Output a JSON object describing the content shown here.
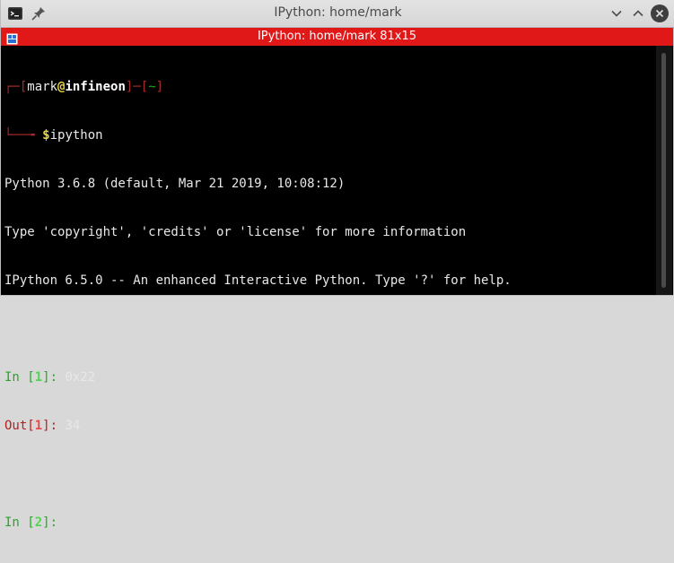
{
  "window": {
    "title": "IPython: home/mark",
    "tab_title": "IPython: home/mark 81x15"
  },
  "icons": {
    "app": "terminal-app-icon",
    "pin": "pin-icon",
    "minimize": "chevron-down-icon",
    "maximize": "chevron-up-icon",
    "close": "close-icon",
    "tab": "split-view-icon"
  },
  "terminal": {
    "prompt": {
      "top_prefix": "┌─[",
      "user": "mark",
      "at": "@",
      "host": "infineon",
      "mid": "]─[",
      "path": "~",
      "end": "]",
      "bottom_prefix": "└──╼ ",
      "dollar": "$",
      "command": "ipython"
    },
    "banner": [
      "Python 3.6.8 (default, Mar 21 2019, 10:08:12)",
      "Type 'copyright', 'credits' or 'license' for more information",
      "IPython 6.5.0 -- An enhanced Interactive Python. Type '?' for help."
    ],
    "in1": {
      "label": "In [",
      "num": "1",
      "close": "]: ",
      "code": "0x22"
    },
    "out1": {
      "label": "Out[",
      "num": "1",
      "close": "]: ",
      "value": "34"
    },
    "in2": {
      "label": "In [",
      "num": "2",
      "close": "]: "
    }
  },
  "colors": {
    "tab_bar": "#e01818",
    "terminal_bg": "#000000"
  }
}
